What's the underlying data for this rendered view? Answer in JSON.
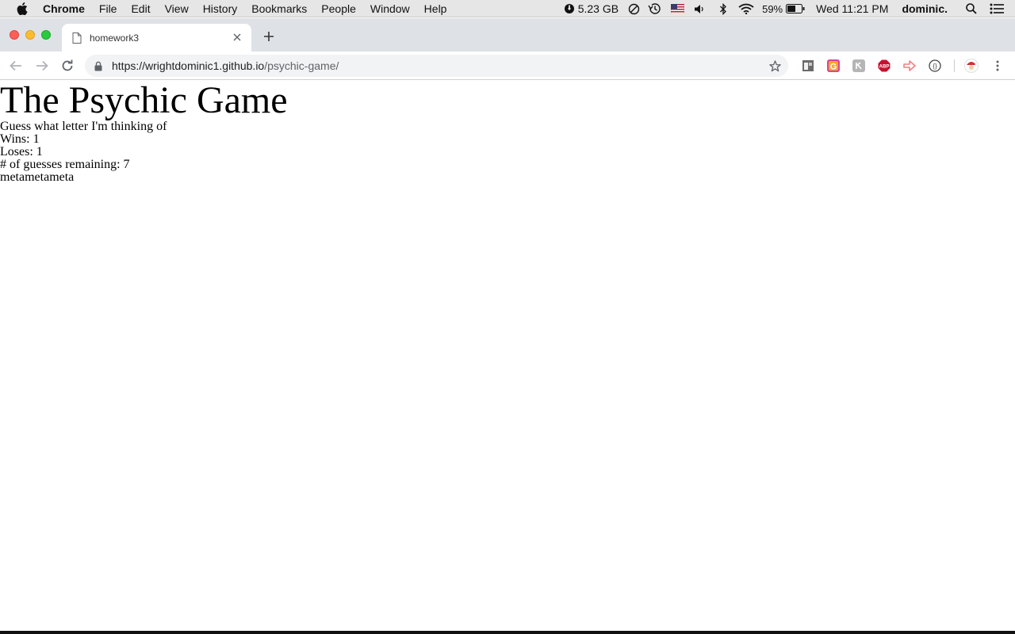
{
  "menubar": {
    "app_name": "Chrome",
    "menus": [
      "File",
      "Edit",
      "View",
      "History",
      "Bookmarks",
      "People",
      "Window",
      "Help"
    ],
    "memory": "5.23 GB",
    "battery_percent": "59%",
    "clock": "Wed 11:21 PM",
    "username": "dominic."
  },
  "browser": {
    "tab_title": "homework3",
    "url_host": "https://wrightdominic1.github.io",
    "url_path": "/psychic-game/"
  },
  "page": {
    "title": "The Psychic Game",
    "prompt": "Guess what letter I'm thinking of",
    "wins": "Wins: 1",
    "loses": "Loses: 1",
    "guesses_remaining": "# of guesses remaining: 7",
    "guesses_so_far": "metametameta"
  },
  "colors": {
    "menubar_bg": "#e6e6e6",
    "tabstrip_bg": "#dee1e6",
    "omnibox_bg": "#f1f3f4",
    "close_light": "#fd5e57",
    "minimize_light": "#fdbb2e",
    "maximize_light": "#29c940"
  }
}
